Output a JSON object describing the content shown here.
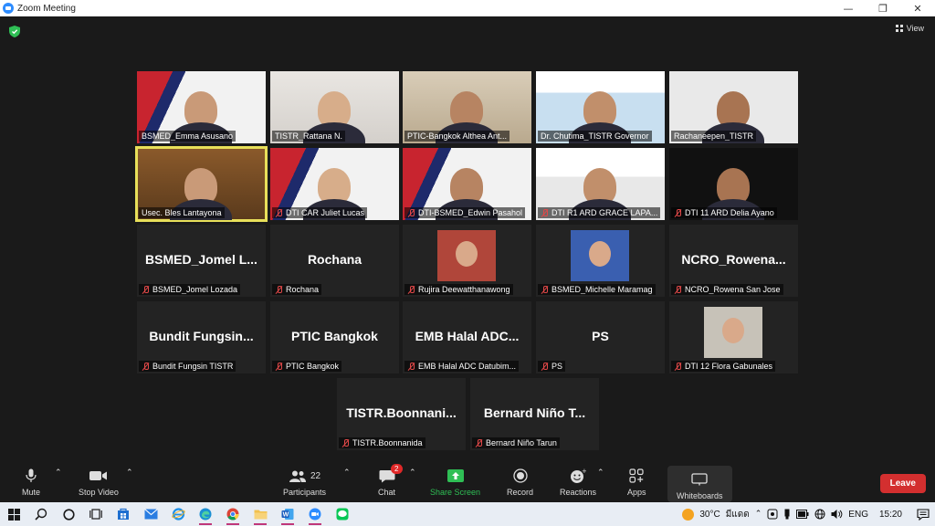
{
  "window": {
    "title": "Zoom Meeting",
    "controls": [
      "—",
      "❐",
      "✕"
    ]
  },
  "view_label": "View",
  "gallery": [
    {
      "name": "BSMED_Emma Asusano",
      "bg": "dti",
      "video": true,
      "muted": false
    },
    {
      "name": "TISTR_Rattana N.",
      "bg": "room",
      "video": true,
      "muted": false
    },
    {
      "name": "PTIC-Bangkok Althea Ant...",
      "bg": "office",
      "video": true,
      "muted": false
    },
    {
      "name": "Dr. Chutima_TISTR Governor",
      "bg": "tistr",
      "video": true,
      "muted": false
    },
    {
      "name": "Rachaneepen_TISTR",
      "bg": "white",
      "video": true,
      "muted": false
    },
    {
      "name": "Usec. Bles Lantayona",
      "bg": "wood",
      "video": true,
      "muted": false,
      "active": true
    },
    {
      "name": "DTI CAR  Juliet Lucas",
      "bg": "dti",
      "video": true,
      "muted": true
    },
    {
      "name": "DTI-BSMED_Edwin Pasahol",
      "bg": "dti",
      "video": true,
      "muted": true
    },
    {
      "name": "DTI R1 ARD GRACE LAPA...",
      "bg": "ph",
      "video": true,
      "muted": true
    },
    {
      "name": "DTI 11 ARD Delia Ayano",
      "bg": "dark",
      "video": true,
      "muted": true
    },
    {
      "name": "BSMED_Jomel Lozada",
      "display": "BSMED_Jomel  L...",
      "video": false,
      "muted": true
    },
    {
      "name": "Rochana",
      "display": "Rochana",
      "video": false,
      "muted": true
    },
    {
      "name": "Rujira Deewatthanawong",
      "avatar": "#b0463a",
      "video": false,
      "muted": true
    },
    {
      "name": "BSMED_Michelle Maramag",
      "avatar": "#3a5fb0",
      "video": false,
      "muted": true
    },
    {
      "name": "NCRO_Rowena San Jose",
      "display": "NCRO_Rowena...",
      "video": false,
      "muted": true
    },
    {
      "name": "Bundit Fungsin TISTR",
      "display": "Bundit  Fungsin...",
      "video": false,
      "muted": true
    },
    {
      "name": "PTIC Bangkok",
      "display": "PTIC Bangkok",
      "video": false,
      "muted": true
    },
    {
      "name": "EMB Halal ADC Datubim...",
      "display": "EMB  Halal  ADC...",
      "video": false,
      "muted": true
    },
    {
      "name": "PS",
      "display": "PS",
      "video": false,
      "muted": true
    },
    {
      "name": "DTI 12 Flora Gabunales",
      "avatar": "#c7c2b8",
      "video": false,
      "muted": true
    },
    {
      "name": "TISTR.Boonnanida",
      "display": "TISTR.Boonnani...",
      "video": false,
      "muted": true
    },
    {
      "name": "Bernard Niño Tarun",
      "display": "Bernard  Niño  T...",
      "video": false,
      "muted": true
    }
  ],
  "toolbar": {
    "mute": "Mute",
    "stop_video": "Stop Video",
    "participants": "Participants",
    "participants_count": "22",
    "chat": "Chat",
    "chat_badge": "2",
    "share_screen": "Share Screen",
    "record": "Record",
    "reactions": "Reactions",
    "apps": "Apps",
    "whiteboards": "Whiteboards",
    "leave": "Leave"
  },
  "taskbar": {
    "temperature": "30°C",
    "weather": "มีแดด",
    "language": "ENG",
    "time": "15:20"
  },
  "colors": {
    "accent_green": "#2fbf55",
    "leave_red": "#d32f2f",
    "active_speaker": "#e8e05a",
    "zoom_blue": "#2d8cff"
  }
}
